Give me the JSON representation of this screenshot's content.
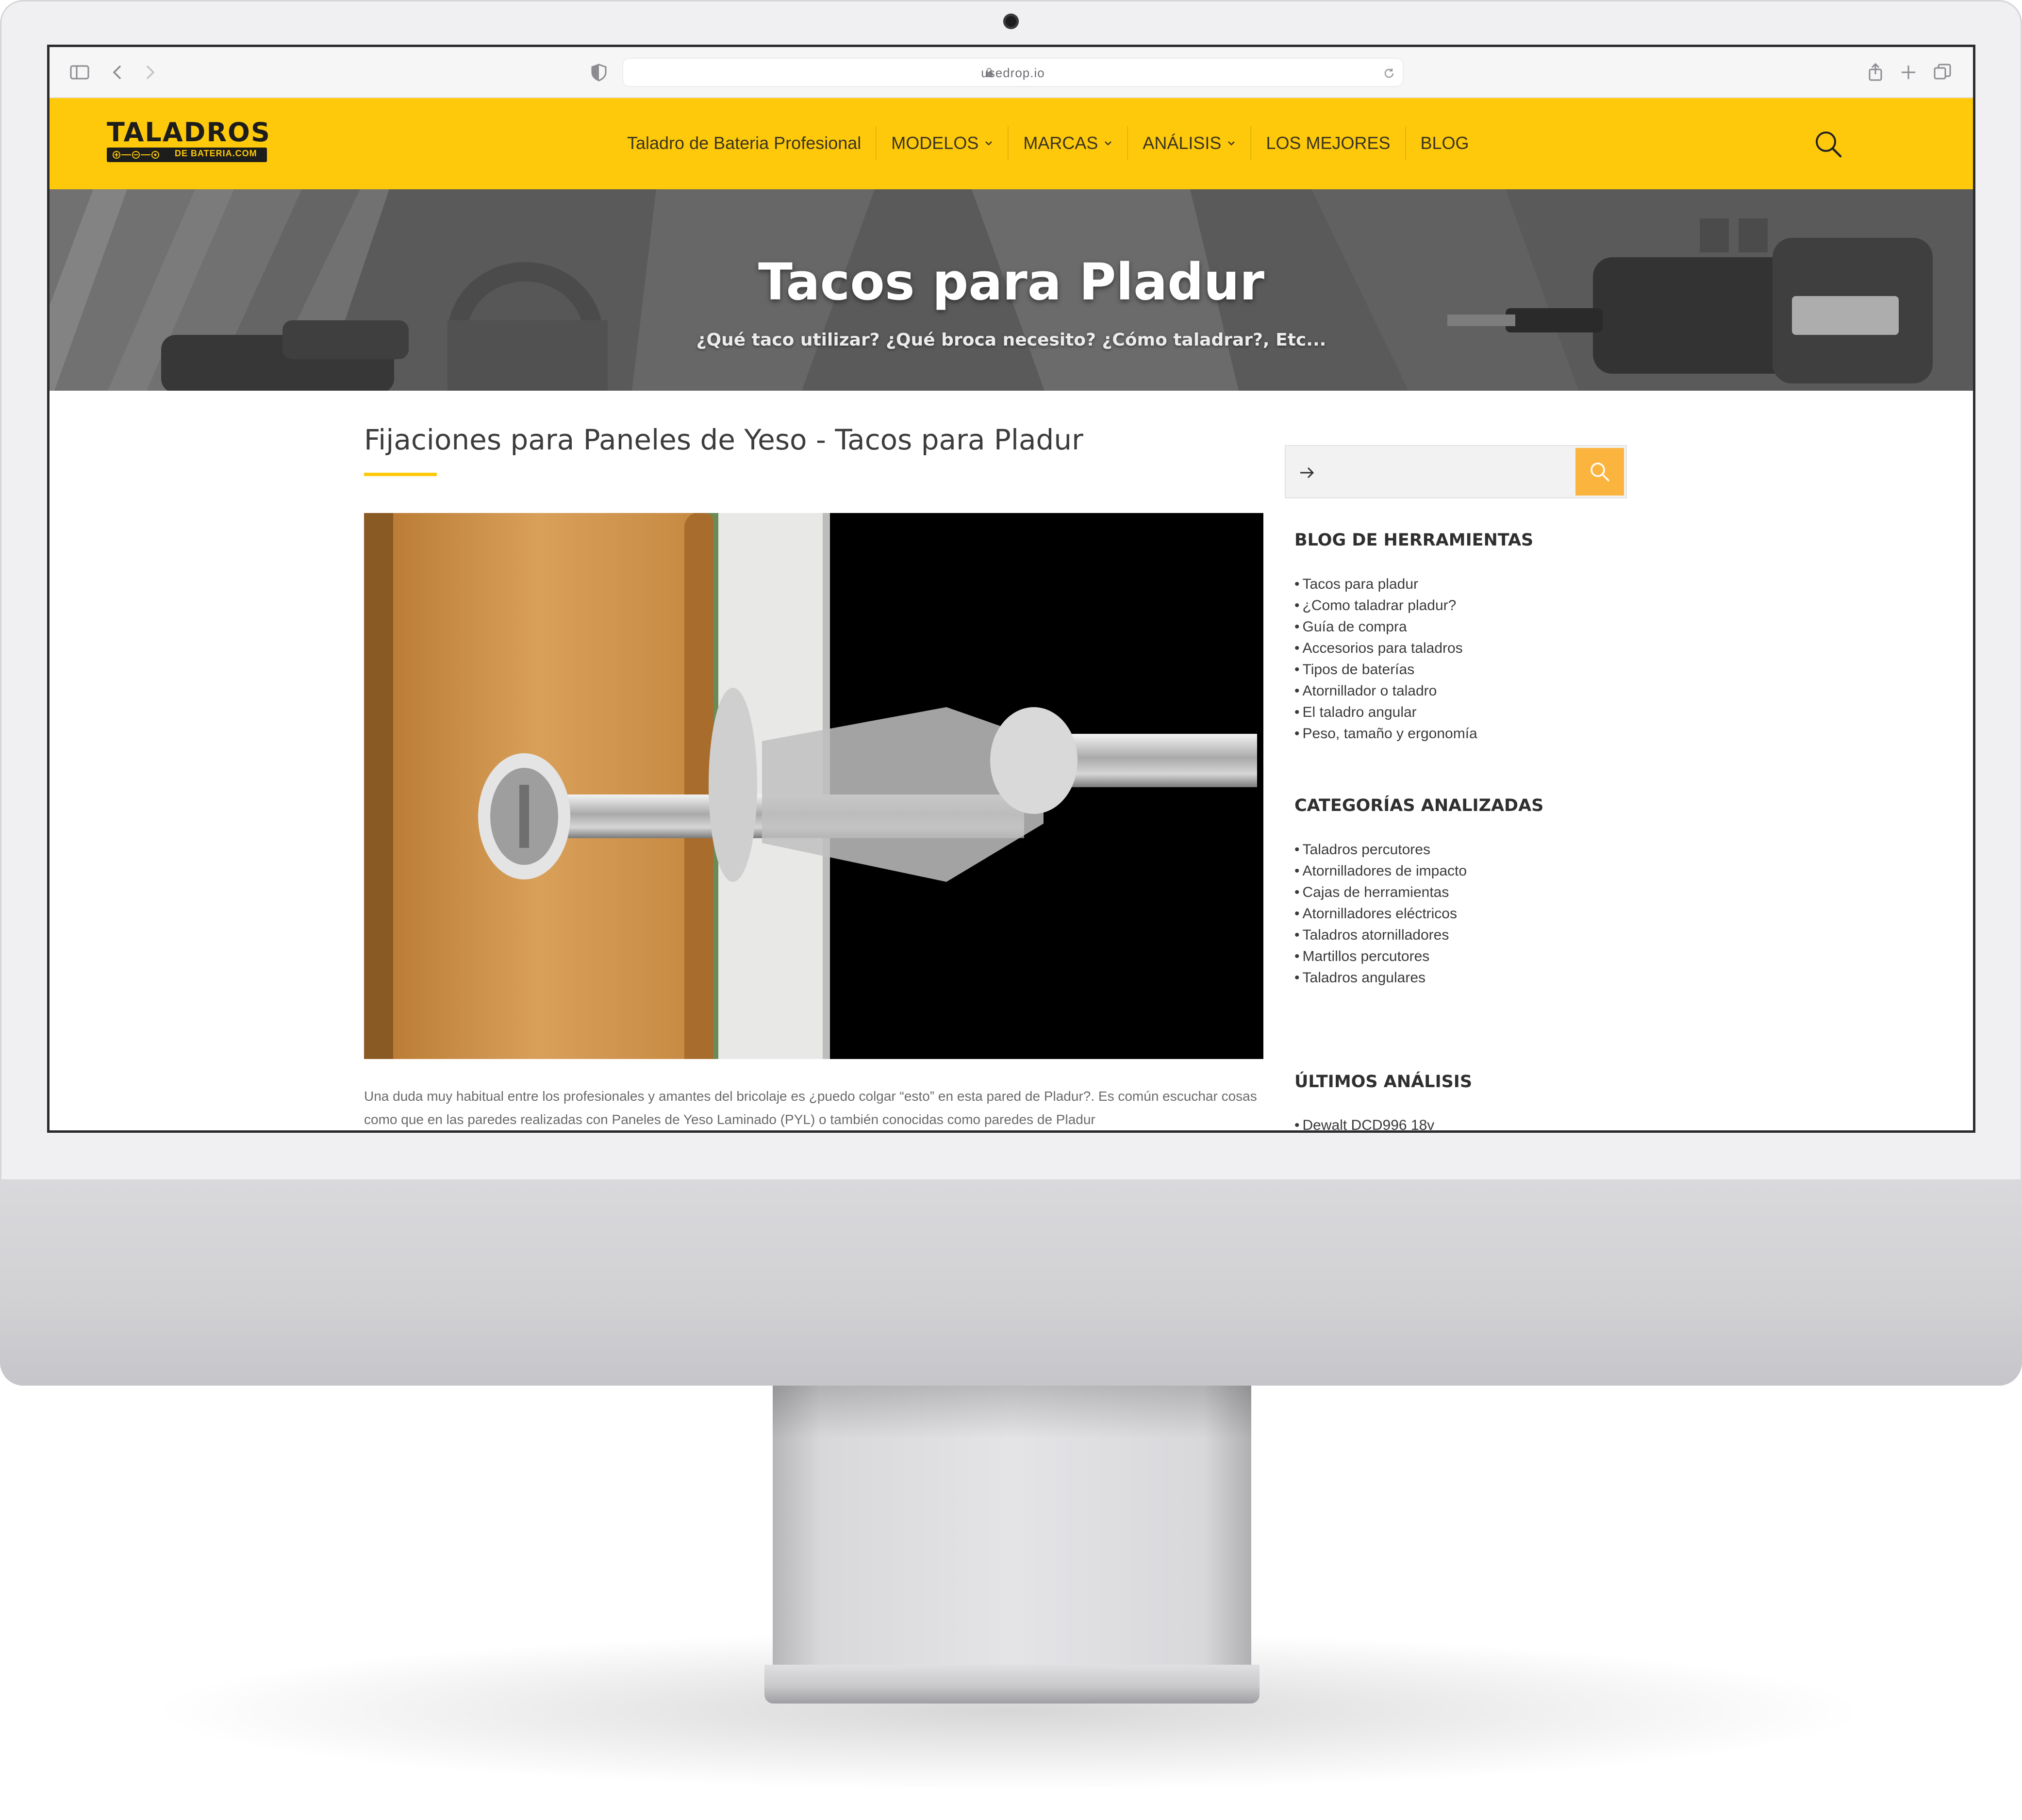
{
  "browser": {
    "url": "usedrop.io"
  },
  "site": {
    "logo_main": "TALADROS",
    "logo_sub": "DE BATERIA.COM",
    "nav": [
      {
        "label": "Taladro de Bateria Profesional",
        "dropdown": false
      },
      {
        "label": "MODELOS",
        "dropdown": true
      },
      {
        "label": "MARCAS",
        "dropdown": true
      },
      {
        "label": "ANÁLISIS",
        "dropdown": true
      },
      {
        "label": "LOS MEJORES",
        "dropdown": false
      },
      {
        "label": "BLOG",
        "dropdown": false
      }
    ],
    "accent_color": "#fec90b"
  },
  "hero": {
    "title": "Tacos para Pladur",
    "subtitle": "¿Qué taco utilizar? ¿Qué broca necesito? ¿Cómo taladrar?, Etc..."
  },
  "article": {
    "title": "Fijaciones para Paneles de Yeso - Tacos para Pladur",
    "paragraph": "Una duda muy habitual entre los profesionales y amantes del bricolaje es ¿puedo colgar “esto” en esta pared de Pladur?. Es común escuchar cosas como que en las paredes realizadas con Paneles de Yeso Laminado (PYL) o también conocidas como paredes de Pladur"
  },
  "sidebar": {
    "blog": {
      "heading": "BLOG DE HERRAMIENTAS",
      "items": [
        "Tacos para pladur",
        "¿Como taladrar pladur?",
        "Guía de compra",
        "Accesorios para taladros",
        "Tipos de baterías",
        "Atornillador o taladro",
        "El taladro angular",
        "Peso, tamaño y ergonomía"
      ]
    },
    "categories": {
      "heading": "CATEGORÍAS ANALIZADAS",
      "items": [
        "Taladros percutores",
        "Atornilladores de impacto",
        "Cajas de herramientas",
        "Atornilladores eléctricos",
        "Taladros atornilladores",
        "Martillos percutores",
        "Taladros angulares"
      ]
    },
    "latest": {
      "heading": "ÚLTIMOS ANÁLISIS",
      "items": [
        "Dewalt DCD996 18v"
      ]
    }
  }
}
